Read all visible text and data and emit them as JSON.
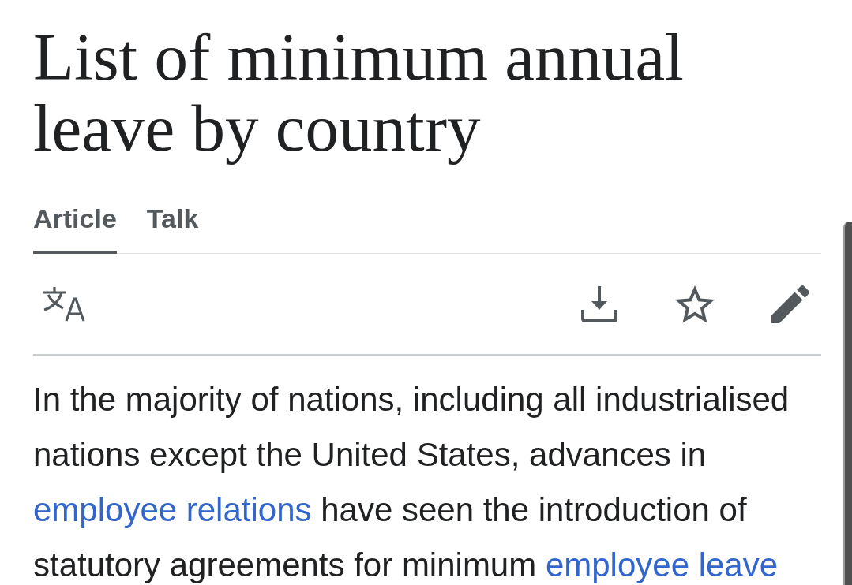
{
  "article": {
    "title": "List of minimum annual leave by country"
  },
  "tabs": [
    {
      "label": "Article",
      "selected": true
    },
    {
      "label": "Talk",
      "selected": false
    }
  ],
  "paragraph": [
    {
      "kind": "text",
      "text": "In the majority of nations, including all industrialised nations except the United States, advances in "
    },
    {
      "kind": "link",
      "text": "employee relations"
    },
    {
      "kind": "text",
      "text": " have seen the introduction of statutory agreements for minimum "
    },
    {
      "kind": "link",
      "text": "employee leave"
    }
  ]
}
